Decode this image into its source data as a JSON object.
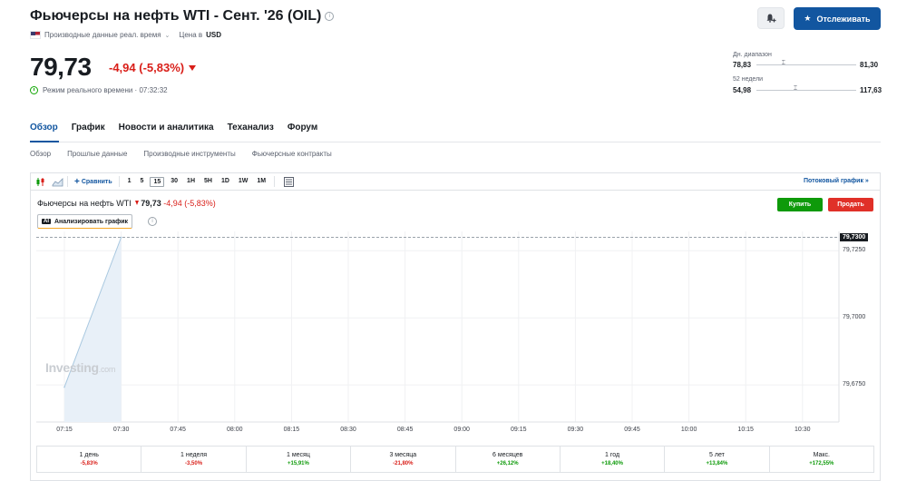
{
  "header": {
    "title": "Фьючерсы на нефть WTI - Сент. '26 (OIL)",
    "data_source": "Производные данные реал. время",
    "currency_label": "Цена в",
    "currency": "USD",
    "follow_label": "Отслеживать"
  },
  "quote": {
    "price": "79,73",
    "change": "-4,94 (-5,83%)",
    "realtime_label": "Режим реального времени · 07:32:32"
  },
  "ranges": {
    "day_label": "Дн. диапазон",
    "day_low": "78,83",
    "day_high": "81,30",
    "day_position": 0.27,
    "week52_label": "52 недели",
    "week52_low": "54,98",
    "week52_high": "117,63",
    "week52_position": 0.39
  },
  "tabs": [
    "Обзор",
    "График",
    "Новости и аналитика",
    "Теханализ",
    "Форум"
  ],
  "subtabs": [
    "Обзор",
    "Прошлые данные",
    "Производные инструменты",
    "Фьючерсные контракты"
  ],
  "toolbar": {
    "compare_label": "Сравнить",
    "intervals": [
      "1",
      "5",
      "15",
      "30",
      "1H",
      "5H",
      "1D",
      "1W",
      "1M"
    ],
    "selected_interval": "15",
    "stream_label": "Потоковый график »"
  },
  "chart_header": {
    "name": "Фьючерсы на нефть WTI",
    "price": "79,73",
    "change": "-4,94 (-5,83%)",
    "analyze_label": "Анализировать график",
    "ai_badge": "AI",
    "buy_label": "Купить",
    "sell_label": "Продать",
    "watermark": "Investing",
    "watermark_suffix": ".com"
  },
  "chart_data": {
    "type": "area",
    "x": [
      "07:15",
      "07:30"
    ],
    "values": [
      79.6742,
      79.73
    ],
    "current_value_label": "79,7300",
    "y_ticks": [
      "79,7250",
      "79,7000",
      "79,6750"
    ],
    "y_tick_values": [
      79.725,
      79.7,
      79.675
    ],
    "ylim": [
      79.6612,
      79.7322
    ],
    "x_ticks": [
      "07:15",
      "07:30",
      "07:45",
      "08:00",
      "08:15",
      "08:30",
      "08:45",
      "09:00",
      "09:15",
      "09:30",
      "09:45",
      "10:00",
      "10:15",
      "10:30"
    ],
    "grid": true,
    "colors": {
      "line": "#a9c8e0",
      "fill": "#e8f0f8",
      "last_price_line": "#9aa3ab"
    }
  },
  "performance": [
    {
      "label": "1 день",
      "value": "-5,83%",
      "dir": "neg"
    },
    {
      "label": "1 неделя",
      "value": "-3,50%",
      "dir": "neg"
    },
    {
      "label": "1 месяц",
      "value": "+15,91%",
      "dir": "pos"
    },
    {
      "label": "3 месяца",
      "value": "-21,80%",
      "dir": "neg"
    },
    {
      "label": "6 месяцев",
      "value": "+26,12%",
      "dir": "pos"
    },
    {
      "label": "1 год",
      "value": "+18,40%",
      "dir": "pos"
    },
    {
      "label": "5 лет",
      "value": "+13,84%",
      "dir": "pos"
    },
    {
      "label": "Макс.",
      "value": "+172,55%",
      "dir": "pos"
    }
  ]
}
